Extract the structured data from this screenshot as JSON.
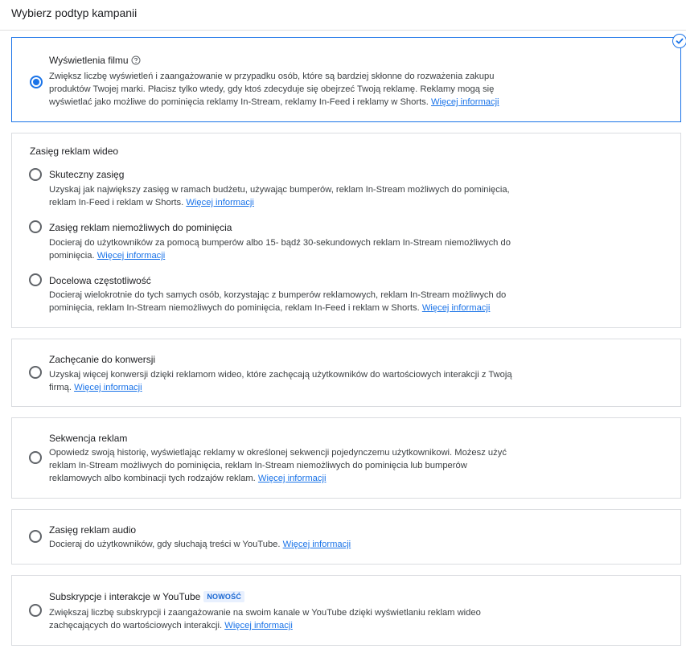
{
  "header": {
    "title": "Wybierz podtyp kampanii"
  },
  "options": {
    "views": {
      "title": "Wyświetlenia filmu",
      "desc_line1": "Zwiększ liczbę wyświetleń i zaangażowanie w przypadku osób, które są bardziej skłonne do rozważenia zakupu",
      "desc_line2": "produktów Twojej marki. Płacisz tylko wtedy, gdy ktoś zdecyduje się obejrzeć Twoją reklamę. Reklamy mogą się",
      "desc_line3": "wyświetlać jako możliwe do pominięcia reklamy In-Stream, reklamy In-Feed i reklamy w Shorts.",
      "link": "Więcej informacji",
      "selected": true
    },
    "reach_group": {
      "title": "Zasięg reklam wideo"
    },
    "efficient_reach": {
      "title": "Skuteczny zasięg",
      "desc_line1": "Uzyskaj jak największy zasięg w ramach budżetu, używając bumperów, reklam In-Stream możliwych do pominięcia,",
      "desc_line2": "reklam In-Feed i reklam w Shorts.",
      "link": "Więcej informacji"
    },
    "non_skippable": {
      "title": "Zasięg reklam niemożliwych do pominięcia",
      "desc_line1": "Docieraj do użytkowników za pomocą bumperów albo 15- bądź 30-sekundowych reklam In-Stream niemożliwych do",
      "desc_line2": "pominięcia.",
      "link": "Więcej informacji"
    },
    "frequency": {
      "title": "Docelowa częstotliwość",
      "desc_line1": "Docieraj wielokrotnie do tych samych osób, korzystając z bumperów reklamowych, reklam In-Stream możliwych do",
      "desc_line2": "pominięcia, reklam In-Stream niemożliwych do pominięcia, reklam In-Feed i reklam w Shorts.",
      "link": "Więcej informacji"
    },
    "conversions": {
      "title": "Zachęcanie do konwersji",
      "desc_line1": "Uzyskaj więcej konwersji dzięki reklamom wideo, które zachęcają użytkowników do wartościowych interakcji z Twoją",
      "desc_line2": "firmą.",
      "link": "Więcej informacji"
    },
    "sequence": {
      "title": "Sekwencja reklam",
      "desc_line1": "Opowiedz swoją historię, wyświetlając reklamy w określonej sekwencji pojedynczemu użytkownikowi. Możesz użyć",
      "desc_line2": "reklam In-Stream możliwych do pominięcia, reklam In-Stream niemożliwych do pominięcia lub bumperów",
      "desc_line3": "reklamowych albo kombinacji tych rodzajów reklam.",
      "link": "Więcej informacji"
    },
    "audio": {
      "title": "Zasięg reklam audio",
      "desc_line1": "Docieraj do użytkowników, gdy słuchają treści w YouTube.",
      "link": "Więcej informacji"
    },
    "subscriptions": {
      "title": "Subskrypcje i interakcje w YouTube",
      "badge": "NOWOŚĆ",
      "desc_line1": "Zwiększaj liczbę subskrypcji i zaangażowanie na swoim kanale w YouTube dzięki wyświetlaniu reklam wideo",
      "desc_line2": "zachęcających do wartościowych interakcji.",
      "link": "Więcej informacji"
    }
  },
  "colors": {
    "accent": "#1a73e8",
    "border": "#dadce0",
    "text": "#3c4043"
  },
  "icons": {
    "help": "help-circle-icon",
    "check": "check-circle-icon"
  }
}
